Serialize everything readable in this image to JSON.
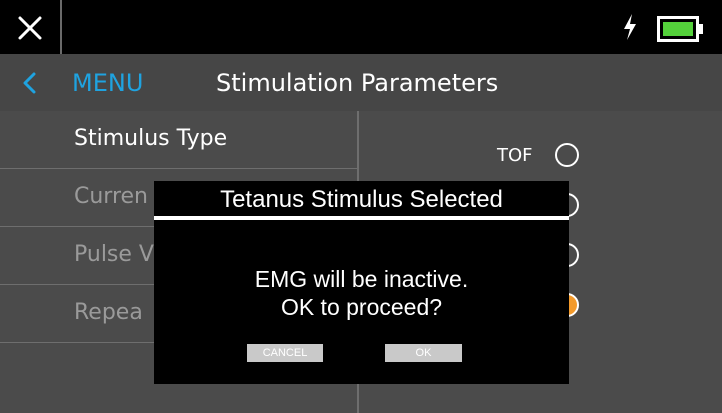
{
  "statusbar": {
    "close_icon": "close-icon",
    "bolt_icon": "bolt-icon",
    "battery_icon": "battery-icon",
    "battery_color": "#54d13b"
  },
  "header": {
    "back_icon": "chevron-left-icon",
    "menu_label": "MENU",
    "title": "Stimulation Parameters",
    "accent": "#1fa3e0"
  },
  "list": {
    "items": [
      {
        "label": "Stimulus Type"
      },
      {
        "label": "Curren"
      },
      {
        "label": "Pulse V"
      },
      {
        "label": "Repea"
      }
    ]
  },
  "options": {
    "items": [
      {
        "label": "TOF",
        "selected": false
      },
      {
        "label": "",
        "selected": false
      },
      {
        "label": "",
        "selected": false
      },
      {
        "label": "",
        "selected": true
      }
    ],
    "selected_color": "#f39a2b"
  },
  "modal": {
    "title": "Tetanus Stimulus Selected",
    "message_line1": "EMG will be inactive.",
    "message_line2": "OK to proceed?",
    "cancel_label": "CANCEL",
    "ok_label": "OK"
  }
}
